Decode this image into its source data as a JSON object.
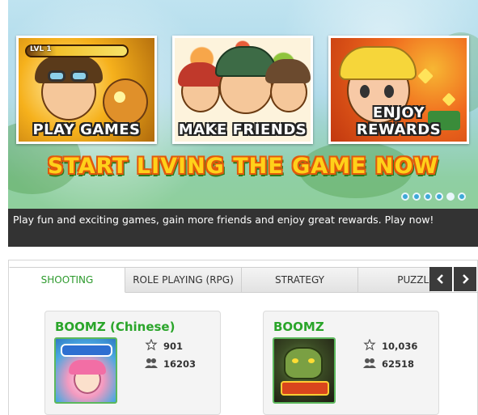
{
  "banner": {
    "cards": [
      {
        "label": "PLAY GAMES",
        "level_label": "LVL 1"
      },
      {
        "label": "MAKE FRIENDS"
      },
      {
        "label": "ENJOY REWARDS"
      }
    ],
    "headline": "START LIVING THE GAME NOW",
    "slide_count": 6,
    "active_slide": 5,
    "caption": "Play fun and exciting games, gain more friends and enjoy great rewards. Play now!"
  },
  "tabs": [
    {
      "label": "SHOOTING",
      "active": true
    },
    {
      "label": "ROLE PLAYING (RPG)",
      "active": false
    },
    {
      "label": "STRATEGY",
      "active": false
    },
    {
      "label": "PUZZLE",
      "active": false
    }
  ],
  "nav": {
    "prev_icon": "chevron-left-icon",
    "next_icon": "chevron-right-icon"
  },
  "games": [
    {
      "title": "BOOMZ (Chinese)",
      "rating": "901",
      "players": "16203"
    },
    {
      "title": "BOOMZ",
      "rating": "10,036",
      "players": "62518"
    }
  ],
  "colors": {
    "accent_green": "#2aa52a",
    "caption_bg": "#333333",
    "headline_yellow": "#ffd11a",
    "headline_outline": "#e15a0c"
  }
}
